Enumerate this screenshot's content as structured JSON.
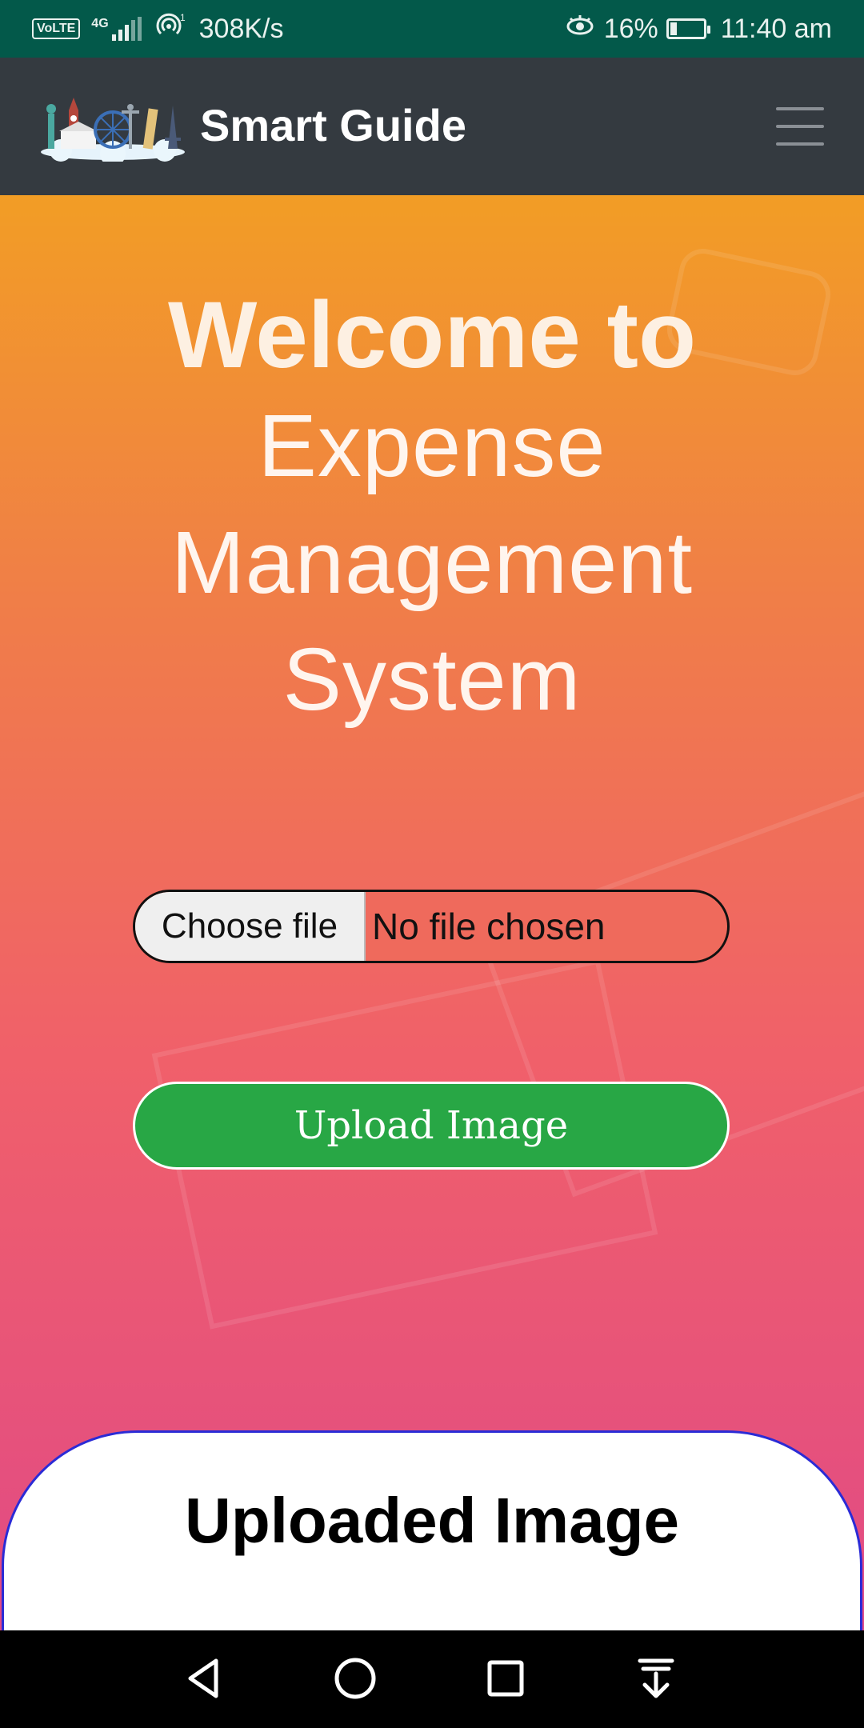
{
  "status_bar": {
    "volte": "VoLTE",
    "network": "4G",
    "speed": "308K/s",
    "battery_percent": "16%",
    "time": "11:40 am"
  },
  "app_bar": {
    "title": "Smart Guide",
    "menu_icon": "hamburger-menu-icon",
    "logo_icon": "world-landmarks-logo"
  },
  "hero": {
    "welcome": "Welcome to",
    "line1": "Expense",
    "line2": "Management",
    "line3": "System",
    "gradient_colors": [
      "#f29d25",
      "#e14a85"
    ]
  },
  "upload_form": {
    "choose_file_label": "Choose file",
    "file_status": "No file chosen",
    "upload_button_label": "Upload Image",
    "upload_button_color": "#28a745"
  },
  "result_card": {
    "title": "Uploaded Image"
  },
  "nav_bar": {
    "icons": [
      "back-icon",
      "home-icon",
      "recents-icon",
      "notifications-pull-icon"
    ]
  }
}
